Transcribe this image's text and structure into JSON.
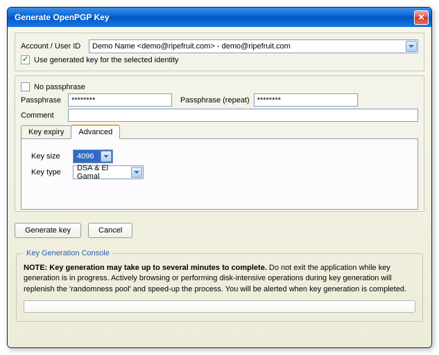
{
  "window": {
    "title": "Generate OpenPGP Key"
  },
  "account": {
    "label": "Account / User ID",
    "value": "Demo Name <demo@ripefruit.com> - demo@ripefruit.com",
    "use_generated": {
      "checked": true,
      "label": "Use generated key for the selected identity"
    }
  },
  "passphrase": {
    "no_pass": {
      "checked": false,
      "label": "No passphrase"
    },
    "label": "Passphrase",
    "value": "********",
    "repeat_label": "Passphrase (repeat)",
    "repeat_value": "********",
    "comment_label": "Comment",
    "comment_value": ""
  },
  "tabs": {
    "expiry": "Key expiry",
    "advanced": "Advanced"
  },
  "advanced": {
    "keysize_label": "Key size",
    "keysize_value": "4096",
    "keytype_label": "Key type",
    "keytype_value": "DSA & El Gamal"
  },
  "buttons": {
    "generate": "Generate key",
    "cancel": "Cancel"
  },
  "console": {
    "legend": "Key Generation Console",
    "note_bold": "NOTE: Key generation may take up to several minutes to complete.",
    "note_rest": " Do not exit the application while key generation is in progress. Actively browsing or performing disk-intensive operations during key generation will replenish the 'randomness pool' and speed-up the process. You will be alerted when key generation is completed."
  }
}
